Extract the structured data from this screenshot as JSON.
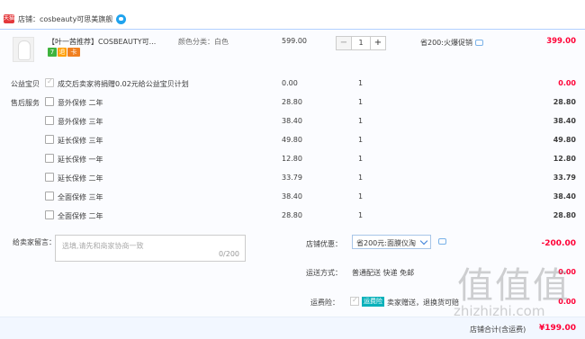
{
  "shop": {
    "badge": "天猫",
    "name": "店铺：cosbeauty可思美旗舰"
  },
  "item": {
    "title": "【叶一茜推荐】COSBEAUTY可...",
    "badges": [
      "7",
      "退",
      "卡"
    ],
    "sku": "颜色分类：白色",
    "price": "599.00",
    "quantity": "1",
    "qty_minus": "−",
    "qty_plus": "+",
    "promo": "省200:火爆促销",
    "total": "399.00"
  },
  "charity": {
    "label": "公益宝贝",
    "text": "成交后卖家将捐赠0.02元给公益宝贝计划",
    "price": "0.00",
    "qty": "1",
    "amount": "0.00"
  },
  "services": {
    "label": "售后服务",
    "rows": [
      {
        "name": "意外保修 二年",
        "price": "28.80",
        "qty": "1",
        "amount": "28.80"
      },
      {
        "name": "意外保修 三年",
        "price": "38.40",
        "qty": "1",
        "amount": "38.40"
      },
      {
        "name": "延长保修 三年",
        "price": "49.80",
        "qty": "1",
        "amount": "49.80"
      },
      {
        "name": "延长保修 一年",
        "price": "12.80",
        "qty": "1",
        "amount": "12.80"
      },
      {
        "name": "延长保修 二年",
        "price": "33.79",
        "qty": "1",
        "amount": "33.79"
      },
      {
        "name": "全面保修 三年",
        "price": "38.40",
        "qty": "1",
        "amount": "38.40"
      },
      {
        "name": "全面保修 二年",
        "price": "28.80",
        "qty": "1",
        "amount": "28.80"
      }
    ]
  },
  "message": {
    "label": "给卖家留言：",
    "placeholder": "选填,请先和商家协商一致",
    "count": "0/200"
  },
  "discount": {
    "label": "店铺优惠：",
    "selected": "省200元:面膜仪淘",
    "amount": "-200.00"
  },
  "transport": {
    "label": "运送方式：",
    "value": "普通配送 快递 免邮",
    "amount": "0.00"
  },
  "insurance": {
    "label": "运费险：",
    "tag": "运费险",
    "text": "卖家赠送，退换货可赔",
    "amount": "0.00"
  },
  "total": {
    "label": "店铺合计(含运费)",
    "amount": "¥199.00"
  },
  "watermark": {
    "logo": "值值值",
    "text": "zhizhizhi.com"
  },
  "colors": {
    "accent_red": "#ff0036",
    "border_blue": "#b2d1ff",
    "panel_bg": "#fbfcff"
  }
}
